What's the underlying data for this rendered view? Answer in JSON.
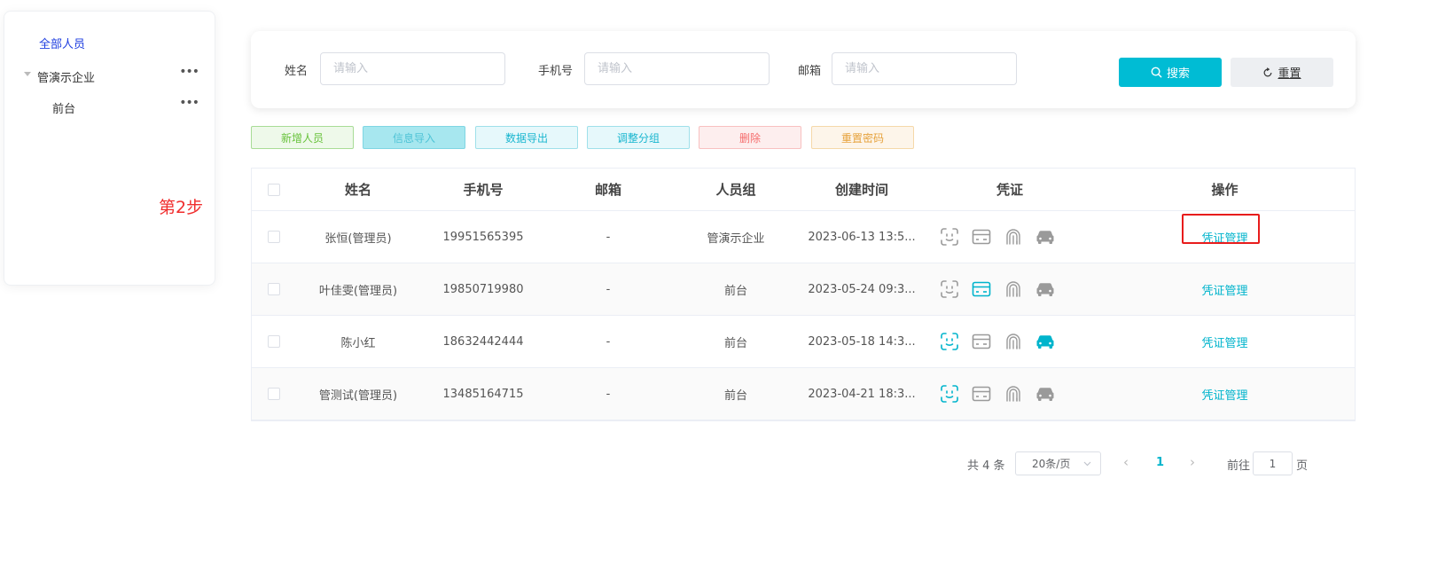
{
  "tree": {
    "all_label": "全部人员",
    "nodes": [
      {
        "label": "管演示企业",
        "more": "•••"
      },
      {
        "label": "前台",
        "more": "•••"
      }
    ]
  },
  "annotation": {
    "step_label": "第2步",
    "color": "#f02d2d"
  },
  "search": {
    "name_label": "姓名",
    "name_placeholder": "请输入",
    "phone_label": "手机号",
    "phone_placeholder": "请输入",
    "email_label": "邮箱",
    "email_placeholder": "请输入",
    "search_button": "搜索",
    "reset_button": "重置"
  },
  "actions": {
    "add": "新增人员",
    "import": "信息导入",
    "export": "数据导出",
    "regroup": "调整分组",
    "delete": "删除",
    "reset_password": "重置密码"
  },
  "table": {
    "headers": {
      "name": "姓名",
      "phone": "手机号",
      "email": "邮箱",
      "group": "人员组",
      "created": "创建时间",
      "credential": "凭证",
      "operation": "操作"
    },
    "rows": [
      {
        "name": "张恒(管理员)",
        "phone": "19951565395",
        "email": "-",
        "group": "管演示企业",
        "created": "2023-06-13 13:5...",
        "op": "凭证管理",
        "creds": {
          "face": false,
          "card": false,
          "fingerprint": false,
          "car": false
        }
      },
      {
        "name": "叶佳雯(管理员)",
        "phone": "19850719980",
        "email": "-",
        "group": "前台",
        "created": "2023-05-24 09:3...",
        "op": "凭证管理",
        "creds": {
          "face": false,
          "card": true,
          "fingerprint": false,
          "car": false
        }
      },
      {
        "name": "陈小红",
        "phone": "18632442444",
        "email": "-",
        "group": "前台",
        "created": "2023-05-18 14:3...",
        "op": "凭证管理",
        "creds": {
          "face": true,
          "card": false,
          "fingerprint": false,
          "car": true
        }
      },
      {
        "name": "管测试(管理员)",
        "phone": "13485164715",
        "email": "-",
        "group": "前台",
        "created": "2023-04-21 18:3...",
        "op": "凭证管理",
        "creds": {
          "face": true,
          "card": false,
          "fingerprint": false,
          "car": false
        }
      }
    ],
    "active_color": "#00b4cc",
    "inactive_color": "#9a9a9a"
  },
  "pagination": {
    "total": "共 4 条",
    "page_size": "20条/页",
    "current": "1",
    "goto_label": "前往",
    "goto_value": "1",
    "page_suffix": "页"
  }
}
